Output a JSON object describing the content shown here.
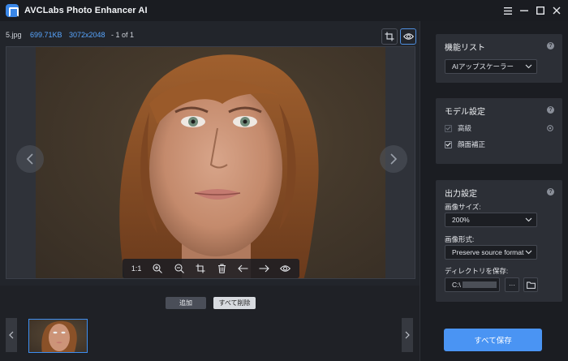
{
  "window": {
    "title": "AVCLabs Photo Enhancer AI",
    "controls": [
      "menu-icon",
      "minimize-icon",
      "maximize-icon",
      "close-icon"
    ]
  },
  "file_info": {
    "name": "5.jpg",
    "size": "699.71KB",
    "dimensions": "3072x2048",
    "count": "- 1 of 1"
  },
  "image_toolbar": {
    "ratio_label": "1:1",
    "tools": [
      "zoom-in-icon",
      "zoom-out-icon",
      "crop-icon",
      "delete-icon",
      "arrow-left-icon",
      "arrow-right-icon",
      "eye-icon"
    ]
  },
  "actions": {
    "add_label": "追加",
    "clear_all_label": "すべて削除"
  },
  "side": {
    "feature_list": {
      "title": "機能リスト",
      "selected": "AIアップスケーラー"
    },
    "model_settings": {
      "title": "モデル設定",
      "options": [
        {
          "label": "高級",
          "checked": true,
          "disabled": true
        },
        {
          "label": "顔面補正",
          "checked": true,
          "disabled": false
        }
      ]
    },
    "output_settings": {
      "title": "出力設定",
      "image_size_label": "画像サイズ:",
      "image_size_value": "200%",
      "image_format_label": "画像形式:",
      "image_format_value": "Preserve source format",
      "directory_label": "ディレクトリを保存:",
      "directory_value": "C:\\",
      "browse_label": "···"
    },
    "save_all_label": "すべて保存"
  },
  "colors": {
    "accent": "#4a94f3",
    "link_blue": "#58a6ff",
    "panel_bg": "#2c2f36",
    "app_bg": "#22252b"
  }
}
